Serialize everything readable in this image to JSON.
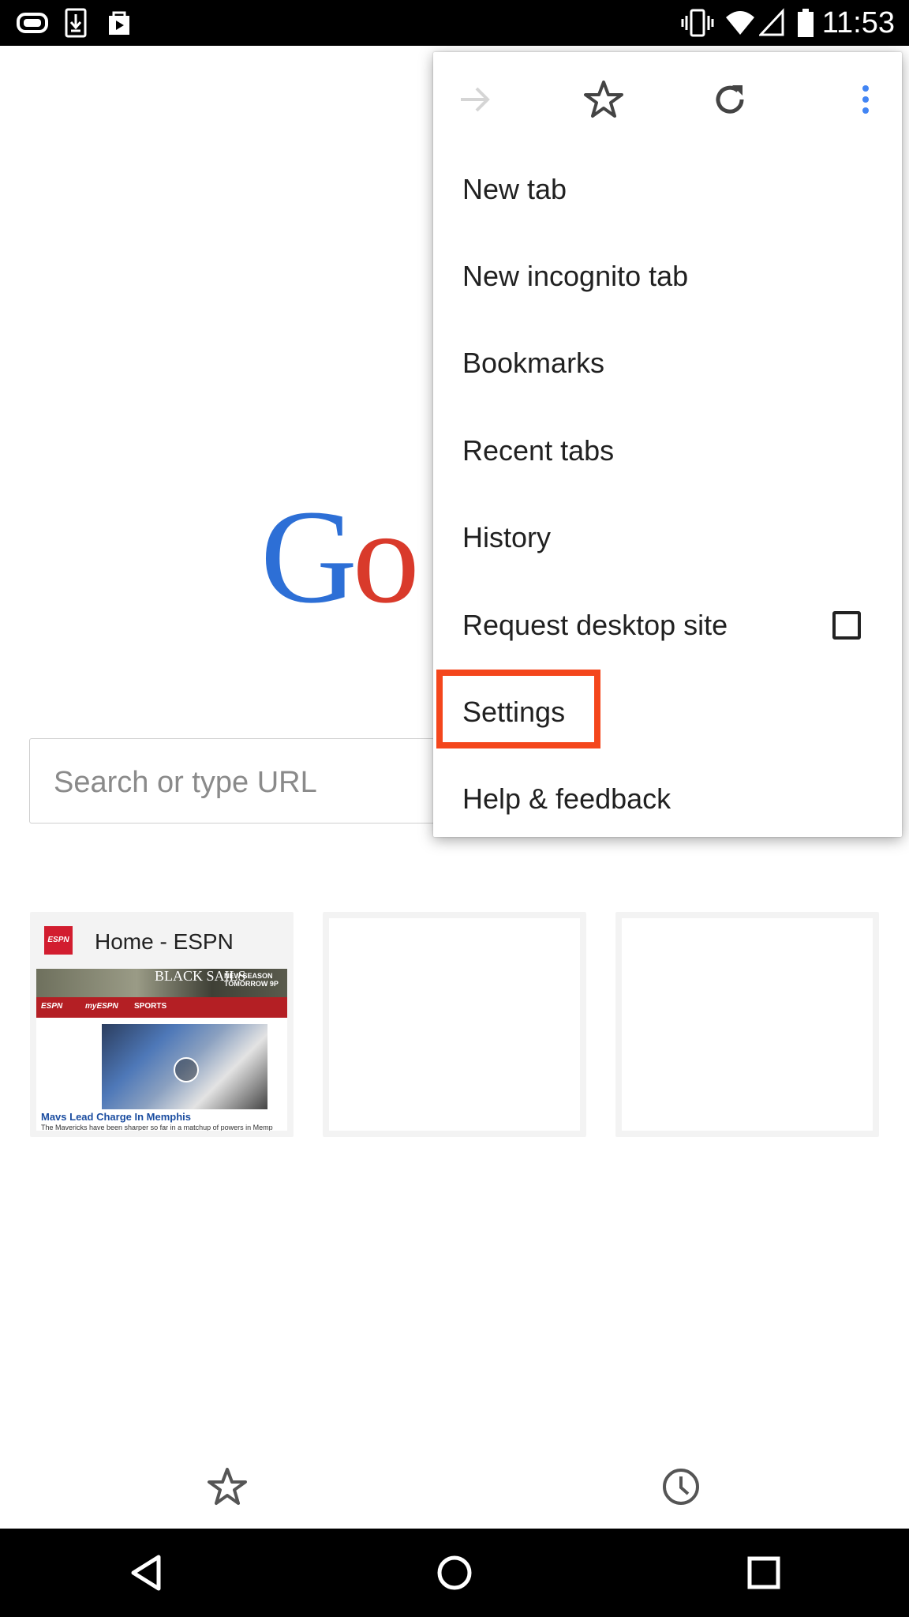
{
  "status_bar": {
    "time": "11:53",
    "left_icons": [
      "game-controller-icon",
      "download-icon",
      "play-store-icon"
    ],
    "right_icons": [
      "vibrate-icon",
      "wifi-icon",
      "signal-icon",
      "battery-icon"
    ]
  },
  "page": {
    "logo_letters": [
      "G",
      "o"
    ],
    "search_placeholder": "Search or type URL",
    "tiles": [
      {
        "title": "Home - ESPN",
        "favicon": "espn",
        "thumbnail": {
          "banner_title": "BLACK SAILS",
          "banner_sub": "NEW SEASON TOMORROW 9P",
          "nav_logo": "ESPN",
          "nav_myespn": "myESPN",
          "nav_sports": "SPORTS",
          "headline": "Mavs Lead Charge In Memphis",
          "subtext": "The Mavericks have been sharper so far in a matchup of powers in Memp"
        }
      },
      {
        "title": ""
      },
      {
        "title": ""
      }
    ]
  },
  "bottom_bar": {
    "left_icon": "bookmarks-star-icon",
    "right_icon": "history-clock-icon"
  },
  "menu": {
    "toolbar": [
      "forward-icon",
      "bookmark-star-icon",
      "reload-icon",
      "more-vert-icon"
    ],
    "items": [
      {
        "label": "New tab"
      },
      {
        "label": "New incognito tab"
      },
      {
        "label": "Bookmarks"
      },
      {
        "label": "Recent tabs"
      },
      {
        "label": "History"
      },
      {
        "label": "Request desktop site",
        "checkbox": false
      },
      {
        "label": "Settings",
        "highlighted": true
      },
      {
        "label": "Help & feedback"
      }
    ],
    "highlight_color": "#f4461c"
  },
  "system_nav": [
    "back-icon",
    "home-icon",
    "recents-icon"
  ],
  "colors": {
    "google_blue": "#2d6fd6",
    "google_red": "#d93a2b",
    "espn_red": "#b41f24",
    "accent_blue": "#4285f4"
  }
}
